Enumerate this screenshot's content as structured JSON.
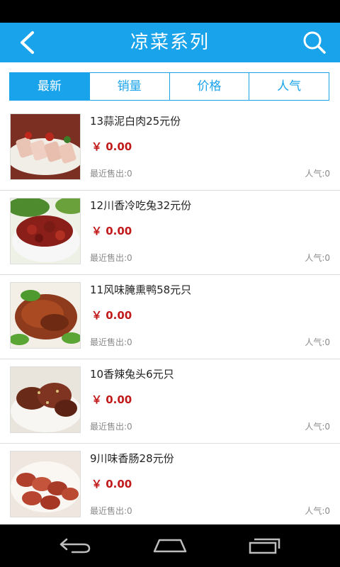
{
  "header": {
    "title": "凉菜系列",
    "back_icon": "back-arrow-icon",
    "search_icon": "search-icon",
    "accent_color": "#19a3ea"
  },
  "tabs": [
    {
      "label": "最新",
      "active": true
    },
    {
      "label": "销量",
      "active": false
    },
    {
      "label": "价格",
      "active": false
    },
    {
      "label": "人气",
      "active": false
    }
  ],
  "items": [
    {
      "name": "13蒜泥白肉25元份",
      "price": "￥ 0.00",
      "sold": "最近售出:0",
      "popularity": "人气:0"
    },
    {
      "name": "12川香冷吃兔32元份",
      "price": "￥ 0.00",
      "sold": "最近售出:0",
      "popularity": "人气:0"
    },
    {
      "name": "11风味腌熏鸭58元只",
      "price": "￥ 0.00",
      "sold": "最近售出:0",
      "popularity": "人气:0"
    },
    {
      "name": "10香辣兔头6元只",
      "price": "￥ 0.00",
      "sold": "最近售出:0",
      "popularity": "人气:0"
    },
    {
      "name": "9川味香肠28元份",
      "price": "￥ 0.00",
      "sold": "最近售出:0",
      "popularity": "人气:0"
    }
  ],
  "price_color": "#c21a1a",
  "system_nav": {
    "back": "nav-back-icon",
    "home": "nav-home-icon",
    "recents": "nav-recents-icon"
  }
}
